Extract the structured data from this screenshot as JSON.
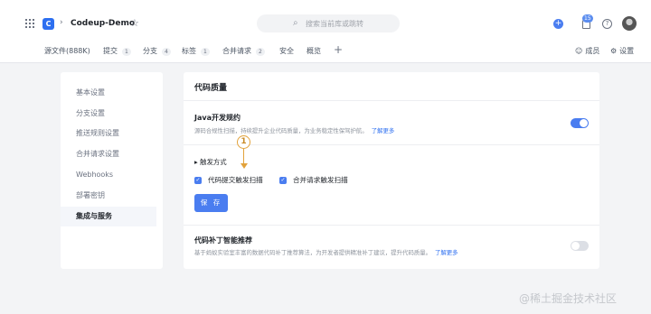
{
  "topbar": {
    "logo_glyph": "C",
    "breadcrumb_sep": "›",
    "repo_name": "Codeup-Demo",
    "star_glyph": "☆",
    "search_placeholder": "搜索当前库或跳转",
    "plus_glyph": "+",
    "notification_count": "15",
    "help_glyph": "?"
  },
  "subnav": {
    "tabs": [
      {
        "label": "源文件(888K)",
        "count": ""
      },
      {
        "label": "提交",
        "count": "1"
      },
      {
        "label": "分支",
        "count": "4"
      },
      {
        "label": "标签",
        "count": "1"
      },
      {
        "label": "合并请求",
        "count": "2"
      },
      {
        "label": "安全",
        "count": ""
      },
      {
        "label": "概览",
        "count": ""
      }
    ],
    "add_glyph": "+",
    "member_label": "成员",
    "settings_label": "设置"
  },
  "sidebar": {
    "items": [
      {
        "label": "基本设置"
      },
      {
        "label": "分支设置"
      },
      {
        "label": "推送规则设置"
      },
      {
        "label": "合并请求设置"
      },
      {
        "label": "Webhooks"
      },
      {
        "label": "部署密钥"
      },
      {
        "label": "集成与服务",
        "active": true
      }
    ]
  },
  "main": {
    "title": "代码质量",
    "java": {
      "title": "Java开发规约",
      "desc": "源码合规性扫描，持续提升企业代码质量，为业务稳定性保驾护航。",
      "more": "了解更多",
      "enabled": true
    },
    "trigger": {
      "label": "▸ 触发方式",
      "option1": "代码提交触发扫描",
      "option2": "合并请求触发扫描",
      "save": "保 存"
    },
    "patch": {
      "title": "代码补丁智能推荐",
      "desc": "基于蚂蚁实验室丰富的数据代码补丁推荐算法，为开发者提供精准补丁建议，提升代码质量。",
      "more": "了解更多",
      "enabled": false
    }
  },
  "annotation": {
    "number": "1",
    "color": "#e2a23b"
  },
  "watermark": "@稀土掘金技术社区",
  "colors": {
    "accent": "#4a7df0",
    "link": "#2d6ff0"
  }
}
